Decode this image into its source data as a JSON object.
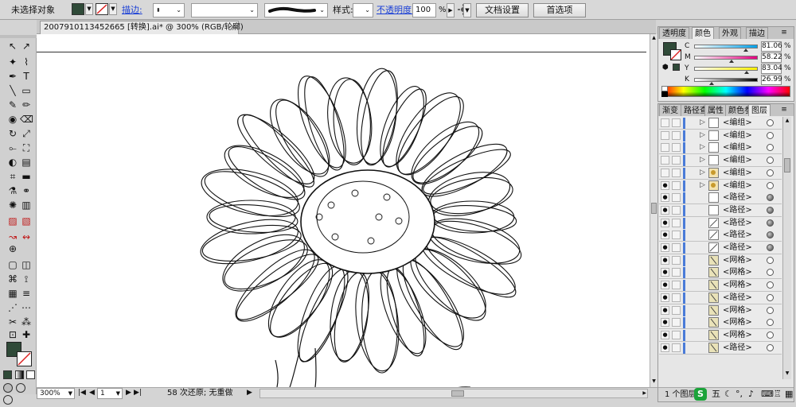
{
  "control_bar": {
    "selection_status": "未选择对象",
    "stroke_label": "描边:",
    "style_label": "样式:",
    "opacity_label": "不透明度:",
    "opacity_value": "100",
    "opacity_unit": "%",
    "doc_setup_button": "文档设置",
    "preferences_button": "首选项"
  },
  "document": {
    "tab_title": "2007910113452665 [转换].ai* @ 300% (RGB/轮廓)",
    "close_glyph": "✕"
  },
  "status_bar": {
    "zoom": "300%",
    "artboard": "1",
    "history_status": "58 次还原; 无重做"
  },
  "color_panel": {
    "tabs": [
      "透明度",
      "颜色",
      "外观",
      "描边"
    ],
    "active_tab": "颜色",
    "channels": [
      {
        "name": "C",
        "value": "81.06",
        "percent": 81.06
      },
      {
        "name": "M",
        "value": "58.22",
        "percent": 58.22
      },
      {
        "name": "Y",
        "value": "83.04",
        "percent": 83.04
      },
      {
        "name": "K",
        "value": "26.99",
        "percent": 26.99
      }
    ],
    "percent_sign": "%",
    "fill_color": "#2f4a38"
  },
  "layers_panel": {
    "tabs": [
      "渐变",
      "路径查",
      "属性",
      "颜色参",
      "图层"
    ],
    "active_tab": "图层",
    "rows": [
      {
        "name": "<编组>",
        "arrow": true,
        "eye": false,
        "thumb": "plain",
        "target_filled": false
      },
      {
        "name": "<编组>",
        "arrow": true,
        "eye": false,
        "thumb": "plain",
        "target_filled": false
      },
      {
        "name": "<编组>",
        "arrow": true,
        "eye": false,
        "thumb": "plain",
        "target_filled": false
      },
      {
        "name": "<编组>",
        "arrow": true,
        "eye": false,
        "thumb": "plain",
        "target_filled": false
      },
      {
        "name": "<编组>",
        "arrow": true,
        "eye": false,
        "thumb": "art",
        "target_filled": false
      },
      {
        "name": "<编组>",
        "arrow": true,
        "eye": true,
        "thumb": "art",
        "target_filled": false
      },
      {
        "name": "<路径>",
        "arrow": false,
        "eye": true,
        "thumb": "plain",
        "target_filled": true
      },
      {
        "name": "<路径>",
        "arrow": false,
        "eye": true,
        "thumb": "plain",
        "target_filled": true
      },
      {
        "name": "<路径>",
        "arrow": false,
        "eye": true,
        "thumb": "line",
        "target_filled": true
      },
      {
        "name": "<路径>",
        "arrow": false,
        "eye": true,
        "thumb": "line",
        "target_filled": true
      },
      {
        "name": "<路径>",
        "arrow": false,
        "eye": true,
        "thumb": "line",
        "target_filled": true
      },
      {
        "name": "<网格>",
        "arrow": false,
        "eye": true,
        "thumb": "mesh",
        "target_filled": false
      },
      {
        "name": "<网格>",
        "arrow": false,
        "eye": true,
        "thumb": "mesh",
        "target_filled": false
      },
      {
        "name": "<网格>",
        "arrow": false,
        "eye": true,
        "thumb": "mesh",
        "target_filled": false
      },
      {
        "name": "<路径>",
        "arrow": false,
        "eye": true,
        "thumb": "mesh",
        "target_filled": false
      },
      {
        "name": "<网格>",
        "arrow": false,
        "eye": true,
        "thumb": "mesh",
        "target_filled": false
      },
      {
        "name": "<网格>",
        "arrow": false,
        "eye": true,
        "thumb": "mesh",
        "target_filled": false
      },
      {
        "name": "<网格>",
        "arrow": false,
        "eye": true,
        "thumb": "mesh",
        "target_filled": false
      },
      {
        "name": "<路径>",
        "arrow": false,
        "eye": true,
        "thumb": "mesh",
        "target_filled": false
      }
    ],
    "footer_status": "1 个图层"
  },
  "tray": {
    "ime_label": "五"
  },
  "colors": {
    "fill": "#2f4a38",
    "link_blue": "#1a3fd6",
    "layer_stripe": "#4a7bd8"
  }
}
